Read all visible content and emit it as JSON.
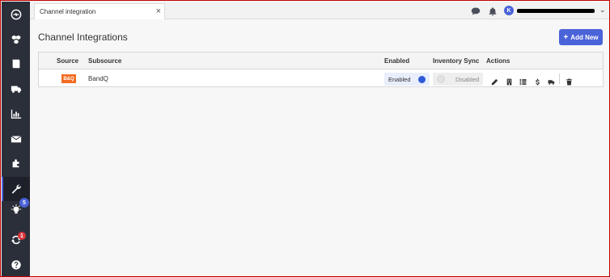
{
  "tab": {
    "label": "Channel integration",
    "close": "×"
  },
  "page": {
    "title": "Channel Integrations",
    "add_button": "Add New",
    "add_plus": "+"
  },
  "user": {
    "initial": "K",
    "name_redacted": true,
    "chevron": "⌄"
  },
  "sidebar": {
    "items": [
      {
        "icon": "sync-circle-icon"
      },
      {
        "icon": "cubes-icon"
      },
      {
        "icon": "book-icon"
      },
      {
        "icon": "truck-icon"
      },
      {
        "icon": "bar-chart-icon"
      },
      {
        "icon": "envelope-icon"
      },
      {
        "icon": "puzzle-icon"
      },
      {
        "icon": "wrench-icon",
        "active": true
      },
      {
        "icon": "lightbulb-icon",
        "badge": "5"
      },
      {
        "icon": "refresh-icon",
        "badge": "1"
      },
      {
        "icon": "help-icon"
      }
    ],
    "badge_colors": {
      "lightbulb": "#4a63d9",
      "refresh": "#d9363e"
    }
  },
  "table": {
    "headers": [
      "Source",
      "Subsource",
      "Enabled",
      "Inventory Sync",
      "Actions"
    ],
    "rows": [
      {
        "source_logo": "B&Q",
        "subsource": "BandQ",
        "enabled": "Enabled",
        "inventory_sync": "Disabled",
        "actions": [
          "pencil-icon",
          "building-icon",
          "list-icon",
          "dollar-icon",
          "truck-icon",
          "trash-icon"
        ]
      }
    ]
  },
  "colors": {
    "accent": "#4a63d9",
    "sidebar": "#2b2f3a",
    "brand_logo": "#f26b21"
  }
}
